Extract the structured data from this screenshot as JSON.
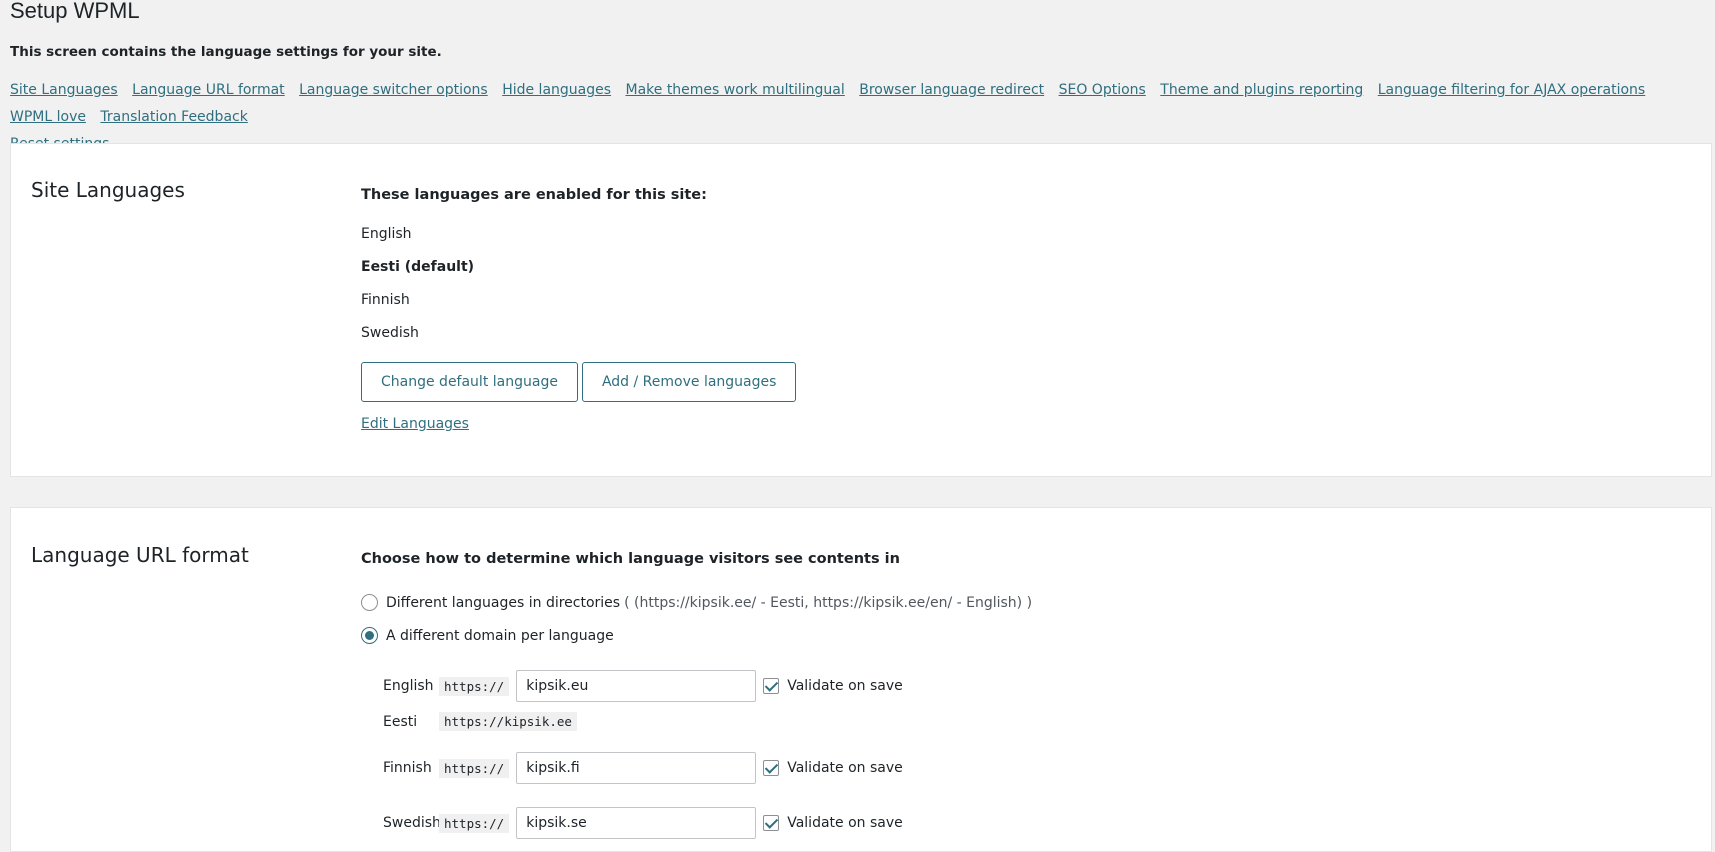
{
  "page": {
    "title": "Setup WPML",
    "description": "This screen contains the language settings for your site."
  },
  "nav": {
    "links": [
      "Site Languages",
      "Language URL format",
      "Language switcher options",
      "Hide languages",
      "Make themes work multilingual",
      "Browser language redirect",
      "SEO Options",
      "Theme and plugins reporting",
      "Language filtering for AJAX operations",
      "WPML love",
      "Translation Feedback",
      "Reset settings"
    ]
  },
  "site_languages": {
    "title": "Site Languages",
    "enabled_heading": "These languages are enabled for this site:",
    "languages": [
      {
        "name": "English",
        "default": false
      },
      {
        "name": "Eesti (default)",
        "default": true
      },
      {
        "name": "Finnish",
        "default": false
      },
      {
        "name": "Swedish",
        "default": false
      }
    ],
    "change_default_button": "Change default language",
    "add_remove_button": "Add / Remove languages",
    "edit_link": "Edit Languages"
  },
  "url_format": {
    "title": "Language URL format",
    "heading": "Choose how to determine which language visitors see contents in",
    "options": [
      {
        "label": "Different languages in directories",
        "hint": "( (https://kipsik.ee/ - Eesti, https://kipsik.ee/en/ - English) )",
        "checked": false
      },
      {
        "label": "A different domain per language",
        "hint": "",
        "checked": true
      }
    ],
    "domains": [
      {
        "lang": "English",
        "prefix": "https://",
        "value": "kipsik.eu",
        "editable": true,
        "validate_label": "Validate on save",
        "validate_checked": true
      },
      {
        "lang": "Eesti",
        "prefix": "https://kipsik.ee",
        "value": "",
        "editable": false
      },
      {
        "lang": "Finnish",
        "prefix": "https://",
        "value": "kipsik.fi",
        "editable": true,
        "validate_label": "Validate on save",
        "validate_checked": true
      },
      {
        "lang": "Swedish",
        "prefix": "https://",
        "value": "kipsik.se",
        "editable": true,
        "validate_label": "Validate on save",
        "validate_checked": true
      }
    ]
  },
  "colors": {
    "accent": "#2f6f7f",
    "background": "#f1f1f1",
    "panel": "#ffffff"
  }
}
